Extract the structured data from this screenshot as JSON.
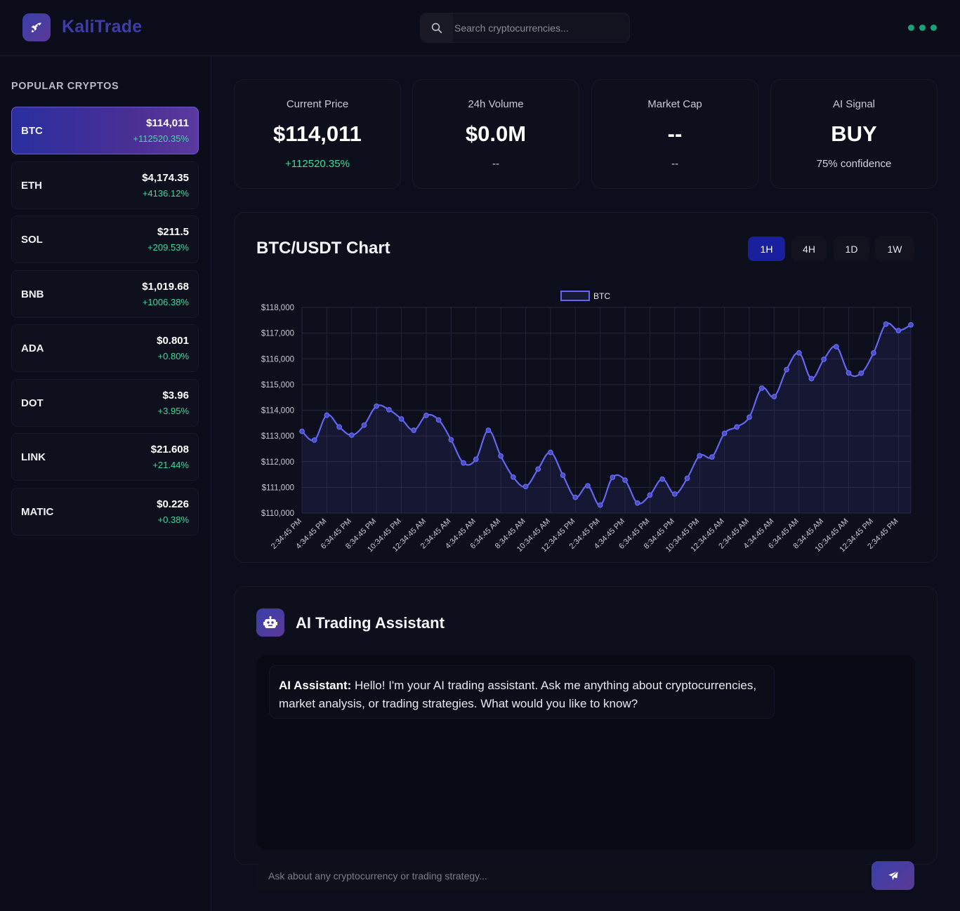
{
  "header": {
    "brand": "KaliTrade",
    "search_placeholder": "Search cryptocurrencies..."
  },
  "sidebar": {
    "title": "POPULAR CRYPTOS",
    "coins": [
      {
        "symbol": "BTC",
        "price": "$114,011",
        "change": "+112520.35%",
        "active": true
      },
      {
        "symbol": "ETH",
        "price": "$4,174.35",
        "change": "+4136.12%"
      },
      {
        "symbol": "SOL",
        "price": "$211.5",
        "change": "+209.53%"
      },
      {
        "symbol": "BNB",
        "price": "$1,019.68",
        "change": "+1006.38%"
      },
      {
        "symbol": "ADA",
        "price": "$0.801",
        "change": "+0.80%"
      },
      {
        "symbol": "DOT",
        "price": "$3.96",
        "change": "+3.95%"
      },
      {
        "symbol": "LINK",
        "price": "$21.608",
        "change": "+21.44%"
      },
      {
        "symbol": "MATIC",
        "price": "$0.226",
        "change": "+0.38%"
      }
    ]
  },
  "stats": [
    {
      "label": "Current Price",
      "value": "$114,011",
      "sub": "+112520.35%"
    },
    {
      "label": "24h Volume",
      "value": "$0.0M",
      "sub": "--"
    },
    {
      "label": "Market Cap",
      "value": "--",
      "sub": "--"
    },
    {
      "label": "AI Signal",
      "value": "BUY",
      "sub": "75% confidence"
    }
  ],
  "chart_panel": {
    "title": "BTC/USDT Chart",
    "timeframes": [
      "1H",
      "4H",
      "1D",
      "1W"
    ],
    "active_timeframe": "1H"
  },
  "chart_data": {
    "type": "area",
    "legend": "top",
    "grid": true,
    "ylim": [
      110000,
      118000
    ],
    "yticks": [
      "$110,000",
      "$111,000",
      "$112,000",
      "$113,000",
      "$114,000",
      "$115,000",
      "$116,000",
      "$117,000",
      "$118,000"
    ],
    "xticks": [
      "2:34:45 PM",
      "4:34:45 PM",
      "6:34:45 PM",
      "8:34:45 PM",
      "10:34:45 PM",
      "12:34:45 AM",
      "2:34:45 AM",
      "4:34:45 AM",
      "6:34:45 AM",
      "8:34:45 AM",
      "10:34:45 AM",
      "12:34:45 PM",
      "2:34:45 PM",
      "4:34:45 PM",
      "6:34:45 PM",
      "8:34:45 PM",
      "10:34:45 PM",
      "12:34:45 AM",
      "2:34:45 AM",
      "4:34:45 AM",
      "6:34:45 AM",
      "8:34:45 AM",
      "10:34:45 AM",
      "12:34:45 PM",
      "2:34:45 PM"
    ],
    "series": [
      {
        "name": "BTC",
        "color": "#6366f1",
        "values": [
          113180,
          112840,
          113810,
          113350,
          113030,
          113420,
          114160,
          114020,
          113660,
          113220,
          113800,
          113620,
          112850,
          111950,
          112090,
          113220,
          112220,
          111400,
          111030,
          111710,
          112360,
          111470,
          110610,
          111060,
          110310,
          111390,
          111280,
          110390,
          110700,
          111320,
          110740,
          111350,
          112230,
          112180,
          113100,
          113350,
          113730,
          114860,
          114530,
          115580,
          116230,
          115230,
          115980,
          116470,
          115450,
          115440,
          116230,
          117350,
          117100,
          117320
        ]
      }
    ]
  },
  "assistant": {
    "title": "AI Trading Assistant",
    "sender": "AI Assistant:",
    "message": " Hello! I'm your AI trading assistant. Ask me anything about cryptocurrencies, market analysis, or trading strategies. What would you like to know?",
    "input_placeholder": "Ask about any cryptocurrency or trading strategy..."
  },
  "colors": {
    "accent": "#1a1f9e",
    "positive": "#3ddc9a",
    "series": "#6366f1"
  }
}
